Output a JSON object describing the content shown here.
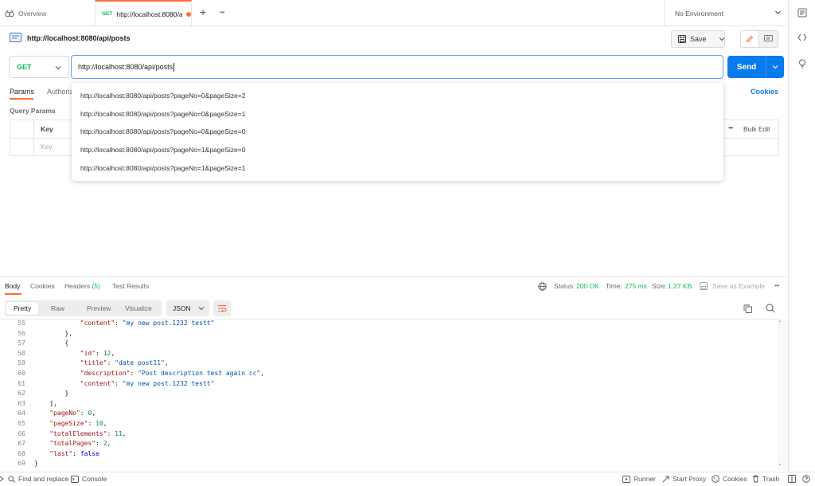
{
  "tabs": {
    "overview_label": "Overview",
    "active": {
      "method": "GET",
      "title": "http://localhost:8080/a"
    },
    "new_tab": "+",
    "more": "•••"
  },
  "environment": {
    "selected": "No Environment"
  },
  "request": {
    "name": "http://localhost:8080/api/posts",
    "save_label": "Save",
    "method": "GET",
    "url": "http://localhost:8080/api/posts",
    "send_label": "Send"
  },
  "params_tabs": [
    "Params",
    "Authoriz"
  ],
  "cookies_link": "Cookies",
  "query_params": {
    "label": "Query Params",
    "key_header": "Key",
    "key_placeholder": "Key",
    "bulk_edit": "Bulk Edit",
    "more": "•••"
  },
  "url_suggestions": [
    "http://localhost:8080/api/posts?pageNo=0&pageSize=2",
    "http://localhost:8080/api/posts?pageNo=0&pageSize=1",
    "http://localhost:8080/api/posts?pageNo=0&pageSize=0",
    "http://localhost:8080/api/posts?pageNo=1&pageSize=0",
    "http://localhost:8080/api/posts?pageNo=1&pageSize=1"
  ],
  "response": {
    "tabs": {
      "body": "Body",
      "cookies": "Cookies",
      "headers": "Headers",
      "headers_count": "(5)",
      "tests": "Test Results"
    },
    "status_label": "Status:",
    "status_value": "200 OK",
    "time_label": "Time:",
    "time_value": "275 ms",
    "size_label": "Size:",
    "size_value": "1.27 KB",
    "save_example": "Save as Example",
    "more": "•••",
    "views": [
      "Pretty",
      "Raw",
      "Preview",
      "Visualize"
    ],
    "format": "JSON",
    "lines": [
      {
        "n": "55",
        "text": "            \"content\": \"my new post.1232 testt\""
      },
      {
        "n": "56",
        "text": "        },"
      },
      {
        "n": "57",
        "text": "        {"
      },
      {
        "n": "58",
        "text": "            \"id\": 12,"
      },
      {
        "n": "59",
        "text": "            \"title\": \"date post11\","
      },
      {
        "n": "60",
        "text": "            \"description\": \"Post description test again cc\","
      },
      {
        "n": "61",
        "text": "            \"content\": \"my new post.1232 testt\""
      },
      {
        "n": "62",
        "text": "        }"
      },
      {
        "n": "63",
        "text": "    ],"
      },
      {
        "n": "64",
        "text": "    \"pageNo\": 0,"
      },
      {
        "n": "65",
        "text": "    \"pageSize\": 10,"
      },
      {
        "n": "66",
        "text": "    \"totalElements\": 11,"
      },
      {
        "n": "67",
        "text": "    \"totalPages\": 2,"
      },
      {
        "n": "68",
        "text": "    \"last\": false"
      },
      {
        "n": "69",
        "text": "}"
      }
    ]
  },
  "footer": {
    "find_replace": "Find and replace",
    "console": "Console",
    "runner": "Runner",
    "start_proxy": "Start Proxy",
    "cookies": "Cookies",
    "trash": "Trash"
  },
  "colors": {
    "accent": "#ff6c37",
    "send": "#097bed",
    "get_method": "#0cbb52",
    "url_focus": "#6a9fe6"
  }
}
